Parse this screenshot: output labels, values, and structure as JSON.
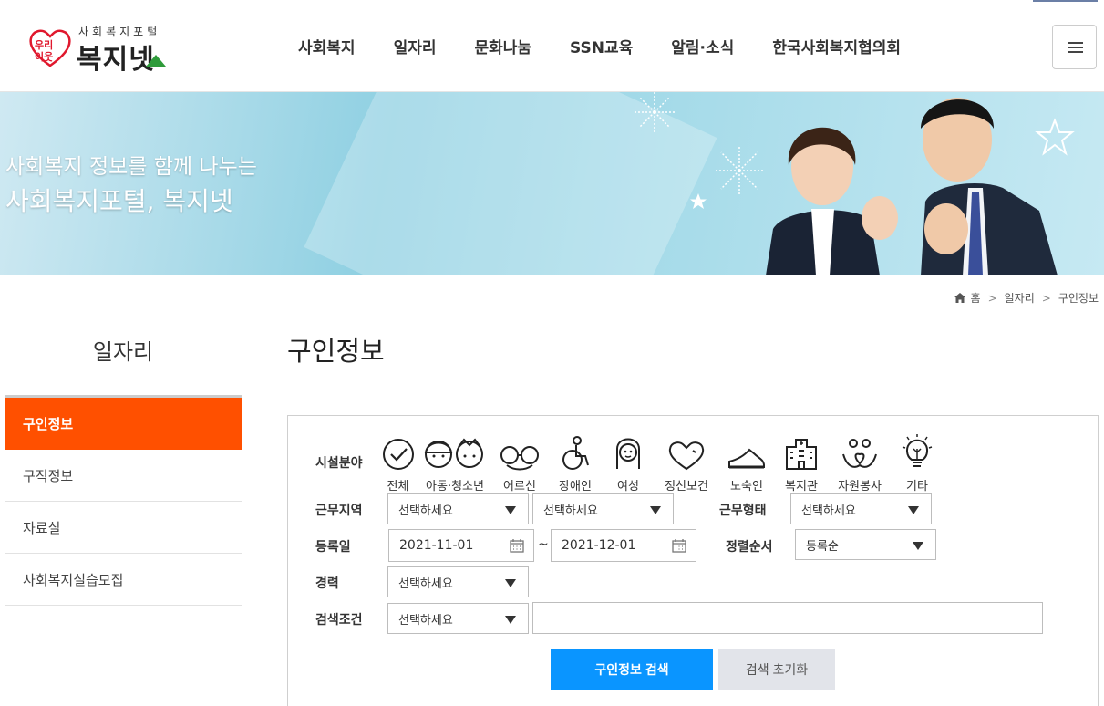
{
  "header": {
    "logo_small": "우리이웃",
    "logo_sub": "사회복지포털",
    "logo_main": "복지넷",
    "nav": [
      "사회복지",
      "일자리",
      "문화나눔",
      "SSN교육",
      "알림·소식",
      "한국사회복지협의회"
    ]
  },
  "banner": {
    "line1": "사회복지 정보를 함께 나누는",
    "line2": "사회복지포털, 복지넷"
  },
  "breadcrumb": [
    "홈",
    "일자리",
    "구인정보"
  ],
  "sidebar": {
    "title": "일자리",
    "items": [
      {
        "label": "구인정보",
        "active": true
      },
      {
        "label": "구직정보",
        "active": false
      },
      {
        "label": "자료실",
        "active": false
      },
      {
        "label": "사회복지실습모집",
        "active": false
      }
    ]
  },
  "main": {
    "title": "구인정보",
    "form": {
      "facility_label": "시설분야",
      "categories": [
        {
          "label": "전체",
          "icon": "check-circle-icon"
        },
        {
          "label": "아동·청소년",
          "icon": "children-icon"
        },
        {
          "label": "어르신",
          "icon": "elderly-icon"
        },
        {
          "label": "장애인",
          "icon": "wheelchair-icon"
        },
        {
          "label": "여성",
          "icon": "woman-icon"
        },
        {
          "label": "정신보건",
          "icon": "heart-icon"
        },
        {
          "label": "노숙인",
          "icon": "shoe-icon"
        },
        {
          "label": "복지관",
          "icon": "building-icon"
        },
        {
          "label": "자원봉사",
          "icon": "volunteer-hands-icon"
        },
        {
          "label": "기타",
          "icon": "lightbulb-icon"
        }
      ],
      "region_label": "근무지역",
      "region1_value": "선택하세요",
      "region2_value": "선택하세요",
      "worktype_label": "근무형태",
      "worktype_value": "선택하세요",
      "date_label": "등록일",
      "date_from": "2021-11-01",
      "date_tilde": "~",
      "date_to": "2021-12-01",
      "sort_label": "정렬순서",
      "sort_value": "등록순",
      "career_label": "경력",
      "career_value": "선택하세요",
      "search_label": "검색조건",
      "search_cond_value": "선택하세요",
      "search_text": "",
      "search_button": "구인정보 검색",
      "reset_button": "검색 초기화"
    }
  },
  "colors": {
    "accent_orange": "#ff5000",
    "search_blue": "#0a95ff",
    "logo_green": "#2e9b3a",
    "logo_red": "#e0182d"
  }
}
